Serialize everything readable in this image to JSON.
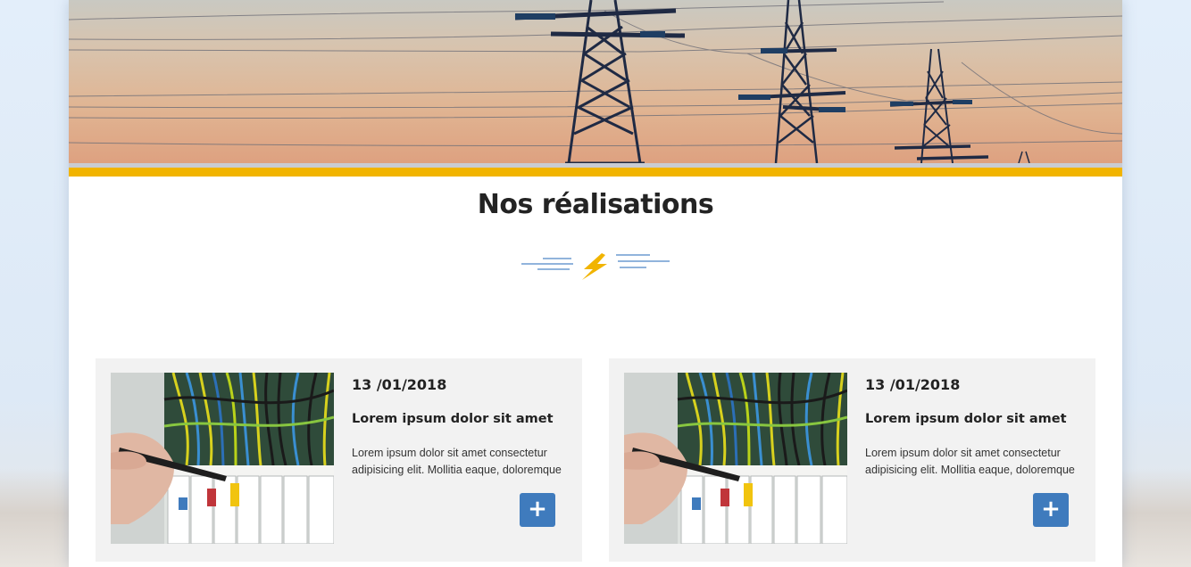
{
  "section": {
    "title": "Nos réalisations",
    "divider_icon": "lightning-bolt-icon"
  },
  "colors": {
    "accent_yellow": "#f1b400",
    "button_blue": "#3f7bbd",
    "card_background": "#f2f2f2",
    "divider_line_blue": "#4f86c6"
  },
  "cards": [
    {
      "date": "13 /01/2018",
      "title": "Lorem ipsum dolor sit amet",
      "text": "Lorem ipsum dolor sit amet consectetur adipisicing elit. Mollitia eaque, doloremque",
      "button_label": "+",
      "image": "electrical-panel-photo"
    },
    {
      "date": "13 /01/2018",
      "title": "Lorem ipsum dolor sit amet",
      "text": "Lorem ipsum dolor sit amet consectetur adipisicing elit. Mollitia eaque, doloremque",
      "button_label": "+",
      "image": "electrical-panel-photo"
    }
  ]
}
